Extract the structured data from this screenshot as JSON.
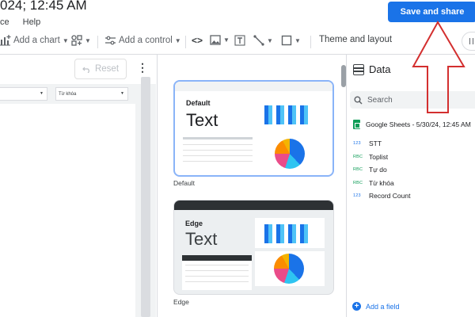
{
  "header": {
    "title": "024; 12:45 AM",
    "menu": [
      "ce",
      "Help"
    ],
    "save_label": "Save and share"
  },
  "toolbar": {
    "add_chart": "Add a chart",
    "add_control": "Add a control",
    "theme_layout": "Theme and layout"
  },
  "left_panel": {
    "reset_label": "Reset",
    "control2_label": "Từ khóa"
  },
  "themes": [
    {
      "name": "Default",
      "sample_text": "Text",
      "caption": "Default"
    },
    {
      "name": "Edge",
      "sample_text": "Text",
      "caption": "Edge"
    }
  ],
  "data_panel": {
    "title": "Data",
    "search_placeholder": "Search",
    "source": "Google Sheets - 5/30/24, 12:45 AM",
    "fields": [
      {
        "type": "123",
        "name": "STT"
      },
      {
        "type": "RBC",
        "name": "Toplist"
      },
      {
        "type": "RBC",
        "name": "Tự do"
      },
      {
        "type": "RBC",
        "name": "Từ khóa"
      },
      {
        "type": "123",
        "name": "Record Count"
      }
    ],
    "add_field": "Add a field"
  },
  "colors": {
    "accent": "#1a73e8",
    "annotation": "#d32f2f"
  }
}
